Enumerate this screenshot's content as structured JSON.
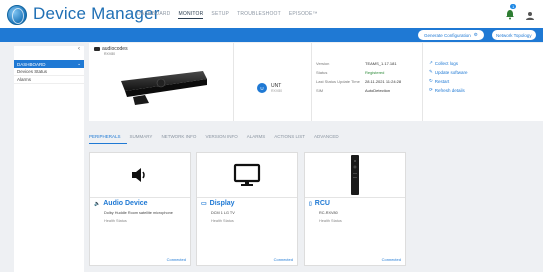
{
  "header": {
    "title": "Device Manager",
    "nav": [
      "DASHBOARD",
      "MONITOR",
      "SETUP",
      "TROUBLESHOOT",
      "EPISODE™"
    ],
    "active_nav": "MONITOR",
    "notification_count": "1",
    "icons": [
      "globe-logo-icon",
      "bell-icon",
      "user-icon"
    ]
  },
  "toolbar": {
    "generate_label": "Generate Configuration",
    "topology_label": "Network Topology"
  },
  "sidebar": {
    "items": [
      {
        "label": "DASHBOARD"
      },
      {
        "label": "Devices Status"
      },
      {
        "label": "Alarms"
      }
    ]
  },
  "device": {
    "brand": "audiocodes",
    "model": "RXV80",
    "avatar_letter": "U",
    "name": "UNT",
    "name_sub": "RXV80",
    "fields": [
      {
        "label": "Version",
        "value": "TEAMS_1.17.181"
      },
      {
        "label": "Status",
        "value": "Registered"
      },
      {
        "label": "Last Status Update Time",
        "value": "28.11.2021 11:24:28"
      },
      {
        "label": "SIM",
        "value": "AutoDetection"
      }
    ],
    "actions": [
      "Collect logs",
      "Update software",
      "Restart",
      "Refresh details"
    ]
  },
  "tabs": [
    "PERIPHERALS",
    "SUMMARY",
    "NETWORK INFO",
    "VERSION INFO",
    "ALARMS",
    "ACTIONS LIST",
    "ADVANCED"
  ],
  "active_tab": "PERIPHERALS",
  "peripherals": [
    {
      "title": "Audio Device",
      "desc": "Dolby Huddle Room satellite microphone",
      "health": "Health Status",
      "status": "Connected",
      "icon": "speaker-icon"
    },
    {
      "title": "Display",
      "desc": "DCM 1 LG TV",
      "health": "Health Status",
      "status": "Connected",
      "icon": "monitor-icon"
    },
    {
      "title": "RCU",
      "desc": "RC-RXV80",
      "health": "Health Status",
      "status": "Connected",
      "icon": "remote-icon"
    }
  ],
  "colors": {
    "accent": "#1f79d4",
    "registered": "#2e8b3a"
  }
}
